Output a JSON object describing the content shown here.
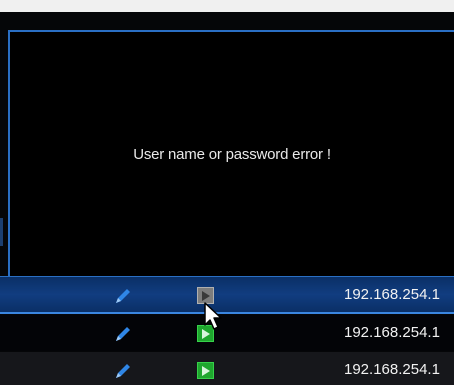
{
  "dialog": {
    "message": "User name or password error !"
  },
  "device_list": {
    "rows": [
      {
        "ip": "192.168.254.1",
        "selected": true,
        "play_state": "inactive",
        "edit_icon": "pencil-icon",
        "play_icon": "play-icon"
      },
      {
        "ip": "192.168.254.1",
        "selected": false,
        "play_state": "active",
        "edit_icon": "pencil-icon",
        "play_icon": "play-icon"
      },
      {
        "ip": "192.168.254.1",
        "selected": false,
        "play_state": "active",
        "edit_icon": "pencil-icon",
        "play_icon": "play-icon"
      }
    ]
  },
  "colors": {
    "accent": "#2a6fc4",
    "selected_row": "#113d80",
    "play_active": "#1fa62e",
    "play_inactive": "#7d7d7d",
    "edit_icon": "#2f86e6"
  },
  "cursor": {
    "icon": "mouse-pointer-icon"
  }
}
